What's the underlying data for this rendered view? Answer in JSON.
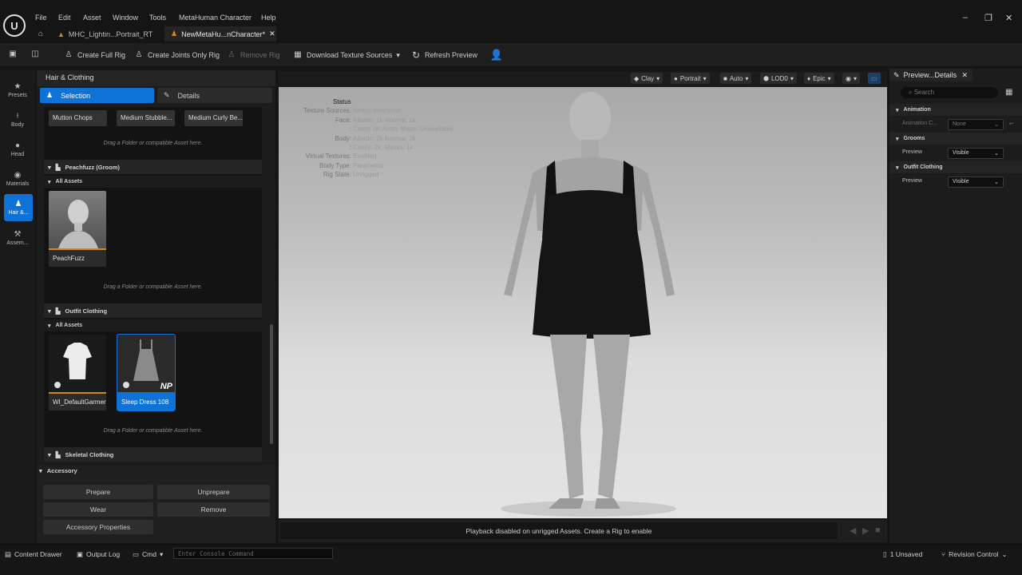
{
  "menu": [
    "File",
    "Edit",
    "Asset",
    "Window",
    "Tools",
    "MetaHuman Character",
    "Help"
  ],
  "tabs": [
    {
      "label": "MHC_Lightin...Portrait_RT"
    },
    {
      "label": "NewMetaHu...nCharacter*"
    }
  ],
  "toolbar": {
    "create_full_rig": "Create Full Rig",
    "create_joints_only": "Create Joints Only Rig",
    "remove_rig": "Remove Rig",
    "download_texture": "Download Texture Sources",
    "refresh_preview": "Refresh Preview"
  },
  "leftnav": [
    {
      "label": "Presets",
      "icon": "star-icon"
    },
    {
      "label": "Body",
      "icon": "body-icon"
    },
    {
      "label": "Head",
      "icon": "head-icon"
    },
    {
      "label": "Materials",
      "icon": "materials-icon"
    },
    {
      "label": "Hair &...",
      "icon": "hair-icon"
    },
    {
      "label": "Assem...",
      "icon": "hammer-icon"
    }
  ],
  "panel": {
    "title": "Hair & Clothing",
    "selection_tab": "Selection",
    "details_tab": "Details",
    "chips": [
      "Mutton Chops",
      "Medium Stubble...",
      "Medium Curly Be..."
    ],
    "drag_hint": "Drag a Folder or compatible Asset here.",
    "peachfuzz_header": "Peachfuzz (Groom)",
    "all_assets": "All Assets",
    "peachfuzz_tile": "PeachFuzz",
    "outfit_header": "Outfit Clothing",
    "outfit_tiles": [
      "WI_DefaultGarment",
      "Sleep Dress 108"
    ],
    "np_badge": "NP",
    "skeletal_header": "Skeletal Clothing",
    "accessory_header": "Accessory",
    "buttons": {
      "prepare": "Prepare",
      "unprepare": "Unprepare",
      "wear": "Wear",
      "remove": "Remove",
      "accessory_properties": "Accessory Properties"
    }
  },
  "viewport": {
    "buttons": [
      "Clay",
      "Portrait",
      "Auto",
      "LOD0",
      "Epic"
    ],
    "status_title": "Status",
    "status": [
      {
        "k": "Texture Sources:",
        "v": "Needs download"
      },
      {
        "k": "Face:",
        "v": "Albedo: 1k Normal: 1k"
      },
      {
        "k": ":",
        "v": "Cavity 1k: Anim. Maps: Unavailable"
      },
      {
        "k": "Body:",
        "v": "Albedo: 2k Normal: 2k"
      },
      {
        "k": ":",
        "v": "Cavity: 2k, Masks: 1k"
      },
      {
        "k": "Virtual Textures:",
        "v": "Enabled"
      },
      {
        "k": "Body Type:",
        "v": "Parametric"
      },
      {
        "k": "Rig State:",
        "v": "Unrigged"
      }
    ],
    "playback": "Playback disabled on unrigged Assets. Create a Rig to enable"
  },
  "details": {
    "tab": "Preview...Details",
    "search_placeholder": "Search",
    "animation": "Animation",
    "animation_row": "Animation C...",
    "animation_value": "None",
    "grooms": "Grooms",
    "preview": "Preview",
    "visible": "Visible",
    "outfit": "Outfit Clothing"
  },
  "statusbar": {
    "content_drawer": "Content Drawer",
    "output_log": "Output Log",
    "cmd": "Cmd",
    "console_placeholder": "Enter Console Command",
    "unsaved": "1 Unsaved",
    "revision": "Revision Control"
  }
}
